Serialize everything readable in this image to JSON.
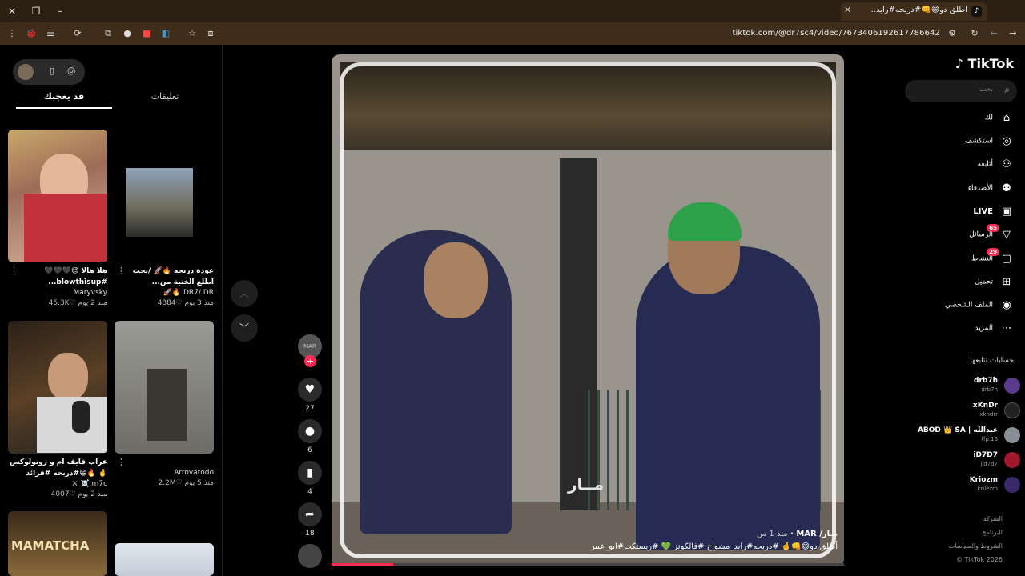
{
  "browser": {
    "tab_title": "أطلق دو😄👊#دربحه#رايد...",
    "tab_favicon": "tiktok-icon",
    "url": "tiktok.com/@dr7sc4/video/7673406192617786642"
  },
  "left": {
    "tabs": {
      "active": "قد يعجبك",
      "inactive": "تعليقات"
    },
    "videos": [
      {
        "caption": "هلا هالا 😊🖤🖤🖤 #blowthisup...",
        "user": "Maryvsky",
        "likes": "45.3K",
        "time": "منذ 2 يوم"
      },
      {
        "caption": "عودة دربحه 🔥🚀 /بحث اطلع الخنية من...",
        "user": "DR7/ DR 🔥🚀",
        "likes": "4884",
        "time": "منذ 3 يوم"
      },
      {
        "caption": "عراب فايف ام و زونولوكس 🤞 🔥😁#دربحه #فرائد",
        "user": "m7c ☠️ ⚔",
        "likes": "4007",
        "time": "منذ 2 يوم"
      },
      {
        "caption": "",
        "user": "Arrovatodo",
        "likes": "2.2M",
        "time": "منذ 5 يوم"
      }
    ],
    "thumb5_text": "MAMATCHA"
  },
  "video": {
    "watermark": "مــار",
    "author": "مـار/ MAR",
    "time": "منذ 1 س",
    "caption": "أطلق دو😄👊🤞 #دربحه#رايد_مشواح #فالكونز 💚 #ريستكت#ابو_عبير",
    "progress": 0.12
  },
  "actions": {
    "likes": "27",
    "comments": "6",
    "saves": "4",
    "shares": "18"
  },
  "nav": {
    "logo": "TikTok",
    "search_placeholder": "بحث",
    "items": [
      {
        "label": "لك",
        "icon": "home-icon"
      },
      {
        "label": "استكشف",
        "icon": "compass-icon"
      },
      {
        "label": "أتابعه",
        "icon": "user-plus-icon"
      },
      {
        "label": "الأصدقاء",
        "icon": "friends-icon"
      },
      {
        "label": "LIVE",
        "icon": "live-icon"
      },
      {
        "label": "الرسائل",
        "icon": "messages-icon",
        "badge": "65"
      },
      {
        "label": "النشاط",
        "icon": "activity-icon",
        "badge": "29"
      },
      {
        "label": "تحميل",
        "icon": "upload-icon"
      },
      {
        "label": "الملف الشخصي",
        "icon": "avatar-icon"
      },
      {
        "label": "المزيد",
        "icon": "more-icon"
      }
    ],
    "following_header": "حسابات تتابعها",
    "following": [
      {
        "name": "drb7h",
        "handle": "drb7h"
      },
      {
        "name": "xKnDr",
        "handle": "xkndrr"
      },
      {
        "name": "ABOD 👑 SA | عبدالله",
        "handle": "ffp.16"
      },
      {
        "name": "iD7D7",
        "handle": "jid7d7"
      },
      {
        "name": "Kriozm",
        "handle": "krilezm"
      }
    ],
    "footer": [
      "الشركة",
      "البرنامج",
      "الشروط والسياسات",
      "© TikTok 2026"
    ]
  }
}
